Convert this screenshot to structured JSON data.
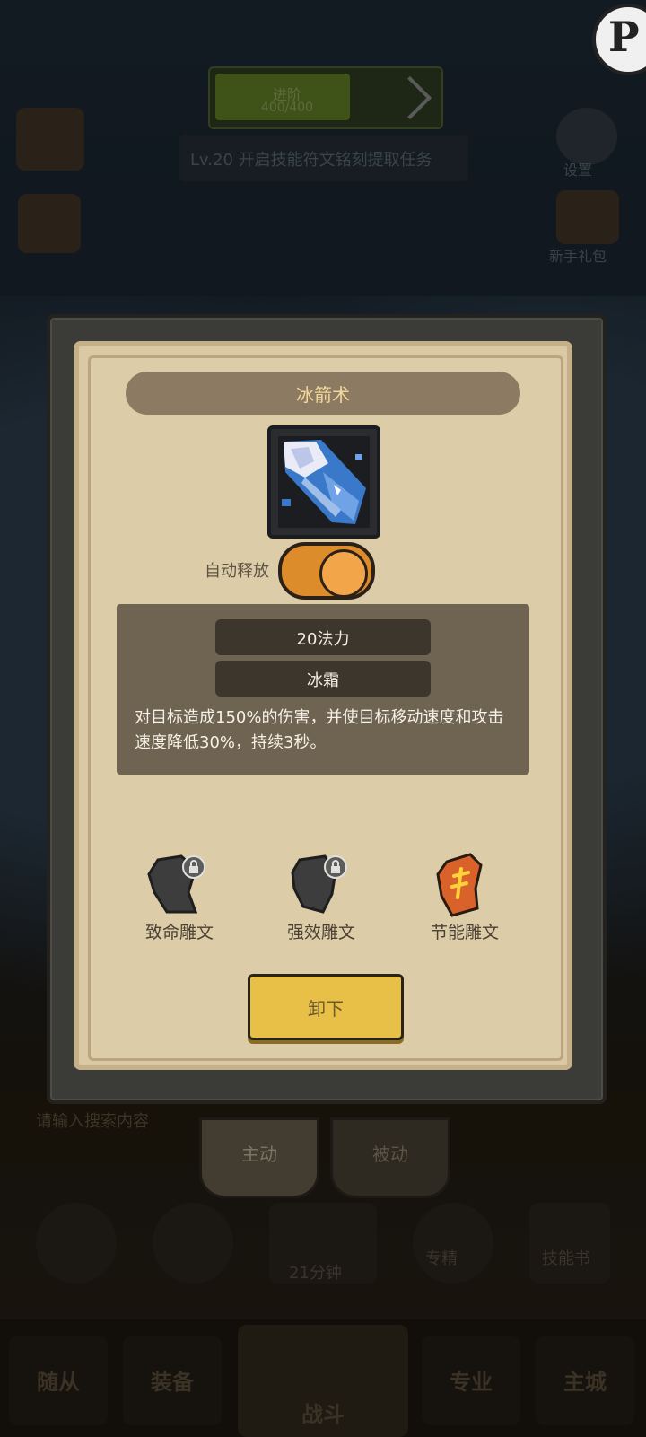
{
  "background": {
    "top_button": {
      "title": "进阶",
      "sub": "400/400"
    },
    "task_text": "Lv.20 开启技能符文铭刻提取任务",
    "left_icons": [
      "",
      ""
    ],
    "right_icons": [
      "设置",
      "新手礼包"
    ],
    "search_placeholder": "请输入搜索内容",
    "tabs_peek": [
      {
        "label": "主动",
        "active": true
      },
      {
        "label": "被动",
        "active": false
      }
    ],
    "timer": "21分钟",
    "bg_labels": [
      "专精",
      "技能书"
    ],
    "bottom_tabs": [
      "随从",
      "装备",
      "战斗",
      "专业",
      "主城"
    ]
  },
  "dialog": {
    "title": "冰箭术",
    "skill_icon": "ice-arrow-icon",
    "auto_cast_label": "自动释放",
    "auto_cast_on": true,
    "cost": "20法力",
    "element": "冰霜",
    "description": "对目标造成150%的伤害，并使目标移动速度和攻击速度降低30%，持续3秒。",
    "runes": [
      {
        "label": "致命雕文",
        "locked": true,
        "color": "#3d3d3d"
      },
      {
        "label": "强效雕文",
        "locked": true,
        "color": "#3d3d3d"
      },
      {
        "label": "节能雕文",
        "locked": false,
        "color": "#d9622b"
      }
    ],
    "unload_label": "卸下"
  },
  "colors": {
    "toggle_on": "#dd8c2c",
    "button_gold": "#e8c048",
    "title_text": "#f1d79a"
  }
}
